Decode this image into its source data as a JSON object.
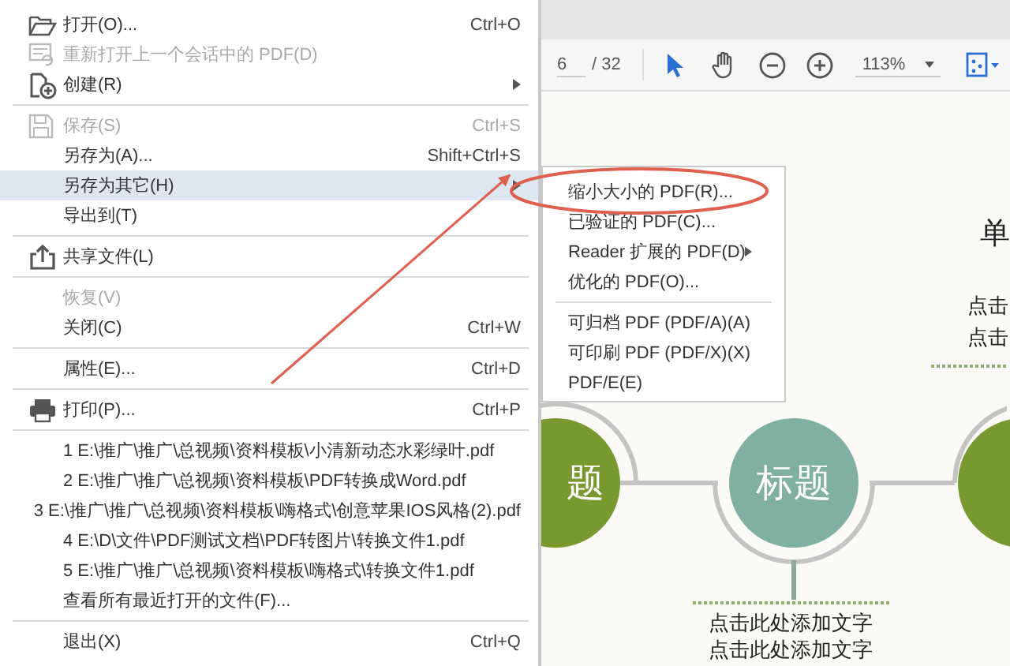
{
  "file_menu": {
    "items": [
      {
        "kind": "item",
        "label": "打开(O)...",
        "shortcut": "Ctrl+O",
        "disabled": false,
        "selected": false
      },
      {
        "kind": "item",
        "label": "重新打开上一个会话中的 PDF(D)",
        "disabled": true,
        "selected": false
      },
      {
        "kind": "item",
        "label": "创建(R)",
        "submenu": true,
        "disabled": false,
        "selected": false
      },
      {
        "kind": "separator"
      },
      {
        "kind": "item",
        "label": "保存(S)",
        "shortcut": "Ctrl+S",
        "disabled": true,
        "selected": false
      },
      {
        "kind": "item",
        "label": "另存为(A)...",
        "shortcut": "Shift+Ctrl+S",
        "disabled": false,
        "selected": false
      },
      {
        "kind": "item",
        "label": "另存为其它(H)",
        "submenu": true,
        "disabled": false,
        "selected": true
      },
      {
        "kind": "item",
        "label": "导出到(T)",
        "disabled": false,
        "selected": false
      },
      {
        "kind": "separator"
      },
      {
        "kind": "item",
        "label": "共享文件(L)",
        "disabled": false,
        "selected": false
      },
      {
        "kind": "separator"
      },
      {
        "kind": "item",
        "label": "恢复(V)",
        "disabled": true,
        "selected": false
      },
      {
        "kind": "item",
        "label": "关闭(C)",
        "shortcut": "Ctrl+W",
        "disabled": false,
        "selected": false
      },
      {
        "kind": "separator"
      },
      {
        "kind": "item",
        "label": "属性(E)...",
        "shortcut": "Ctrl+D",
        "disabled": false,
        "selected": false
      },
      {
        "kind": "separator"
      },
      {
        "kind": "item",
        "label": "打印(P)...",
        "shortcut": "Ctrl+P",
        "disabled": false,
        "selected": false
      },
      {
        "kind": "separator"
      },
      {
        "kind": "item",
        "label": "1 E:\\推广\\推广\\总视频\\资料模板\\小清新动态水彩绿叶.pdf",
        "disabled": false,
        "selected": false
      },
      {
        "kind": "item",
        "label": "2 E:\\推广\\推广\\总视频\\资料模板\\PDF转换成Word.pdf",
        "disabled": false,
        "selected": false
      },
      {
        "kind": "item",
        "label": "3 E:\\推广\\推广\\总视频\\资料模板\\嗨格式\\创意苹果IOS风格(2).pdf",
        "disabled": false,
        "selected": false
      },
      {
        "kind": "item",
        "label": "4 E:\\D\\文件\\PDF测试文档\\PDF转图片\\转换文件1.pdf",
        "disabled": false,
        "selected": false
      },
      {
        "kind": "item",
        "label": "5 E:\\推广\\推广\\总视频\\资料模板\\嗨格式\\转换文件1.pdf",
        "disabled": false,
        "selected": false
      },
      {
        "kind": "item",
        "label": "查看所有最近打开的文件(F)...",
        "disabled": false,
        "selected": false
      },
      {
        "kind": "separator"
      },
      {
        "kind": "item",
        "label": "退出(X)",
        "shortcut": "Ctrl+Q",
        "disabled": false,
        "selected": false
      }
    ]
  },
  "submenu": {
    "items": [
      {
        "kind": "item",
        "label": "缩小大小的 PDF(R)..."
      },
      {
        "kind": "item",
        "label": "已验证的 PDF(C)..."
      },
      {
        "kind": "item",
        "label": "Reader 扩展的 PDF(D)",
        "submenu": true
      },
      {
        "kind": "item",
        "label": "优化的 PDF(O)..."
      },
      {
        "kind": "separator"
      },
      {
        "kind": "item",
        "label": "可归档 PDF (PDF/A)(A)"
      },
      {
        "kind": "item",
        "label": "可印刷 PDF (PDF/X)(X)"
      },
      {
        "kind": "item",
        "label": "PDF/E(E)"
      }
    ]
  },
  "toolbar": {
    "page_number": "6",
    "page_total": "/ 32",
    "zoom": "113%"
  },
  "document": {
    "heading": "单",
    "side_texts": [
      "点击",
      "点击"
    ],
    "nodes": [
      {
        "label": "题",
        "color": "#77992f"
      },
      {
        "label": "标题",
        "color": "#80b0a2"
      },
      {
        "color": "#77992f"
      }
    ],
    "captions": [
      "点击此处添加文字",
      "点击此处添加文字"
    ]
  }
}
